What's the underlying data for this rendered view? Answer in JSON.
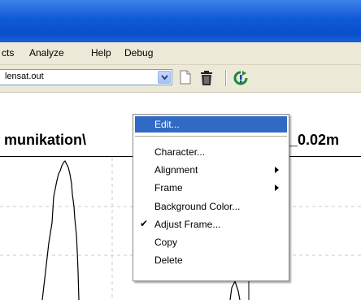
{
  "menubar": {
    "items": [
      {
        "label": "cts"
      },
      {
        "label": "Analyze"
      },
      {
        "label": "Help"
      },
      {
        "label": "Debug"
      }
    ]
  },
  "toolbar": {
    "file_combo_value": "lensat.out"
  },
  "canvas": {
    "heading_left": "munikation\\",
    "heading_right": "_0.02m"
  },
  "context_menu": {
    "items": [
      {
        "label": "Edit...",
        "highlighted": true
      },
      {
        "label": "Character..."
      },
      {
        "label": "Alignment",
        "submenu": true
      },
      {
        "label": "Frame",
        "submenu": true
      },
      {
        "label": "Background Color..."
      },
      {
        "label": "Adjust Frame...",
        "checked": true
      },
      {
        "label": "Copy"
      },
      {
        "label": "Delete"
      }
    ]
  },
  "colors": {
    "titlebar": "#0a4fcc",
    "menu_highlight": "#316ac5",
    "chrome": "#ece9d8"
  }
}
